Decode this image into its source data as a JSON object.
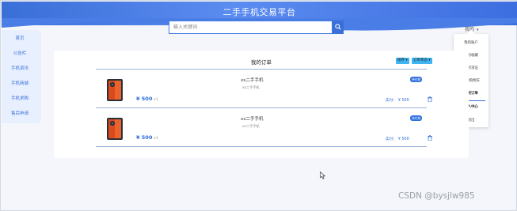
{
  "header": {
    "title": "二手手机交易平台"
  },
  "search": {
    "placeholder": "输入关键词"
  },
  "user_menu": {
    "label": "我的",
    "items": [
      "我的账户",
      "我的收藏",
      "我的求证",
      "我的购物车",
      "我的订单",
      "个人中心",
      "退出"
    ]
  },
  "sidebar": {
    "items": [
      "首页",
      "公告栏",
      "手机资讯",
      "手机商城",
      "手机求购",
      "售后申请"
    ]
  },
  "orders_panel": {
    "title": "我的订单",
    "filters": [
      "排序 ▾",
      "订单状态 ▾"
    ],
    "paid_prefix": "实付：",
    "orders": [
      {
        "name": "xx二手手机",
        "desc": "xx二手手机",
        "price": "¥ 500",
        "qty": "×1",
        "status": "待付款",
        "paid": "实付： ¥ 500"
      },
      {
        "name": "xx二手手机",
        "desc": "xx二手手机",
        "price": "¥ 500",
        "qty": "×1",
        "status": "待付款",
        "paid": "实付： ¥ 500"
      }
    ]
  },
  "watermark": "CSDN @bysjlw985",
  "colors": {
    "accent": "#3a6fd8",
    "filter": "#3fb6f2",
    "sidebar_bg": "#e8f0ff"
  }
}
